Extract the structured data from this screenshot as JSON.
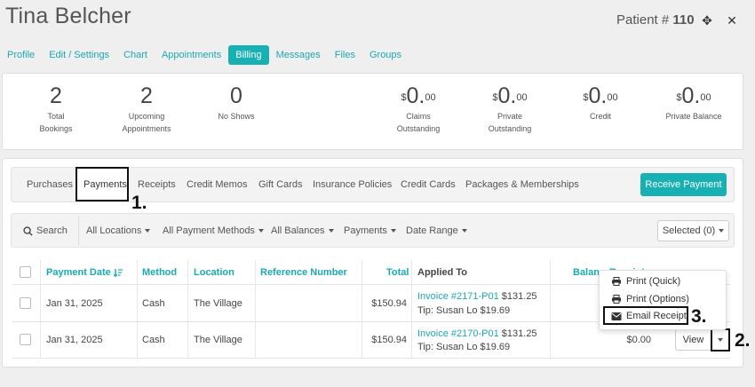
{
  "header": {
    "patient_name": "Tina Belcher",
    "patient_prefix": "Patient # ",
    "patient_number": "110",
    "expand_glyph": "✥",
    "close_glyph": "✕"
  },
  "top_tabs": [
    {
      "label": "Profile"
    },
    {
      "label": "Edit / Settings"
    },
    {
      "label": "Chart"
    },
    {
      "label": "Appointments"
    },
    {
      "label": "Billing",
      "active": true
    },
    {
      "label": "Messages"
    },
    {
      "label": "Files"
    },
    {
      "label": "Groups"
    }
  ],
  "stats": {
    "total_bookings": {
      "value": "2",
      "label1": "Total",
      "label2": "Bookings"
    },
    "upcoming": {
      "value": "2",
      "label1": "Upcoming",
      "label2": "Appointments"
    },
    "no_shows": {
      "value": "0",
      "label1": "No Shows"
    },
    "claims": {
      "currency": "$",
      "amount": "0.",
      "cents": "00",
      "label1": "Claims",
      "label2": "Outstanding"
    },
    "private_out": {
      "currency": "$",
      "amount": "0.",
      "cents": "00",
      "label1": "Private",
      "label2": "Outstanding"
    },
    "credit": {
      "currency": "$",
      "amount": "0.",
      "cents": "00",
      "label1": "Credit"
    },
    "private_balance": {
      "currency": "$",
      "amount": "0.",
      "cents": "00",
      "label1": "Private Balance"
    }
  },
  "subtabs": [
    "Purchases",
    "Payments",
    "Receipts",
    "Credit Memos",
    "Gift Cards",
    "Insurance Policies",
    "Credit Cards",
    "Packages & Memberships"
  ],
  "receive_payment_label": "Receive Payment",
  "steps": {
    "one": "1.",
    "two": "2.",
    "three": "3."
  },
  "filters": {
    "search": "Search",
    "locations": "All Locations",
    "methods": "All Payment Methods",
    "balances": "All Balances",
    "payments": "Payments",
    "date_range": "Date Range",
    "selected": "Selected (0)"
  },
  "table": {
    "headers": {
      "payment_date": "Payment Date",
      "method": "Method",
      "location": "Location",
      "reference": "Reference Number",
      "total": "Total",
      "applied_to": "Applied To",
      "balance": "Balance",
      "receipt": "Receipt"
    },
    "rows": [
      {
        "date": "Jan 31, 2025",
        "method": "Cash",
        "location": "The Village",
        "total": "$150.94",
        "invoice": "Invoice #2171-P01",
        "invoice_amount": " $131.25",
        "tip": "Tip: Susan Lo $19.69"
      },
      {
        "date": "Jan 31, 2025",
        "method": "Cash",
        "location": "The Village",
        "total": "$150.94",
        "invoice": "Invoice #2170-P01",
        "invoice_amount": " $131.25",
        "tip": "Tip: Susan Lo $19.69",
        "balance": "$0.00",
        "view": "View"
      }
    ]
  },
  "menu": {
    "print_quick": "Print (Quick)",
    "print_options": "Print (Options)",
    "email_receipt": "Email Receipt"
  }
}
